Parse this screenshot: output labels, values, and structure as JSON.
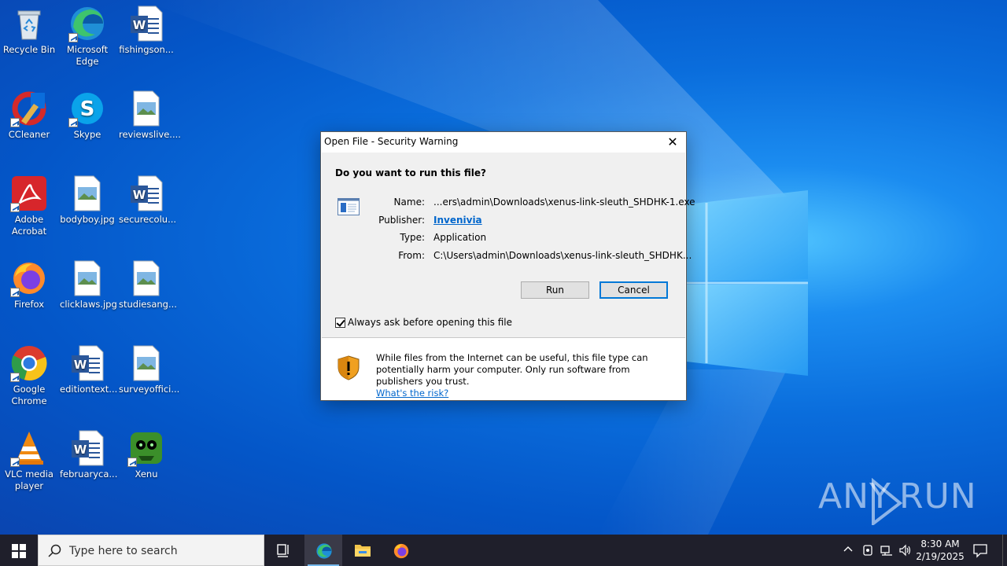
{
  "desktop": {
    "icons": [
      {
        "label": "Recycle Bin",
        "icon": "recycle-bin-icon"
      },
      {
        "label": "Microsoft Edge",
        "icon": "edge-icon"
      },
      {
        "label": "fishingson...",
        "icon": "word-document-icon"
      },
      {
        "label": "CCleaner",
        "icon": "ccleaner-icon"
      },
      {
        "label": "Skype",
        "icon": "skype-icon"
      },
      {
        "label": "reviewslive....",
        "icon": "image-file-icon"
      },
      {
        "label": "Adobe Acrobat",
        "icon": "acrobat-icon"
      },
      {
        "label": "bodyboy.jpg",
        "icon": "image-file-icon"
      },
      {
        "label": "securecolu...",
        "icon": "word-document-icon"
      },
      {
        "label": "Firefox",
        "icon": "firefox-icon"
      },
      {
        "label": "clicklaws.jpg",
        "icon": "image-file-icon"
      },
      {
        "label": "studiesang...",
        "icon": "image-file-icon"
      },
      {
        "label": "Google Chrome",
        "icon": "chrome-icon"
      },
      {
        "label": "editiontext...",
        "icon": "word-document-icon"
      },
      {
        "label": "surveyoffici...",
        "icon": "image-file-icon"
      },
      {
        "label": "VLC media player",
        "icon": "vlc-icon"
      },
      {
        "label": "februaryca...",
        "icon": "word-document-icon"
      },
      {
        "label": "Xenu",
        "icon": "xenu-icon"
      }
    ]
  },
  "dialog": {
    "title": "Open File - Security Warning",
    "question": "Do you want to run this file?",
    "name_label": "Name:",
    "name_value": "...ers\\admin\\Downloads\\xenus-link-sleuth_SHDHK-1.exe",
    "publisher_label": "Publisher:",
    "publisher_value": "Invenivia",
    "type_label": "Type:",
    "type_value": "Application",
    "from_label": "From:",
    "from_value": "C:\\Users\\admin\\Downloads\\xenus-link-sleuth_SHDHK...",
    "run_label": "Run",
    "cancel_label": "Cancel",
    "always_ask_label": "Always ask before opening this file",
    "always_ask_checked": true,
    "warning_text": "While files from the Internet can be useful, this file type can potentially harm your computer. Only run software from publishers you trust.",
    "risk_link": "What's the risk?"
  },
  "watermark": {
    "left": "ANY",
    "right": "RUN"
  },
  "taskbar": {
    "search_placeholder": "Type here to search",
    "time": "8:30 AM",
    "date": "2/19/2025"
  },
  "colors": {
    "accent": "#0078d7",
    "link": "#0066cc",
    "taskbar": "#1f1f2b"
  }
}
